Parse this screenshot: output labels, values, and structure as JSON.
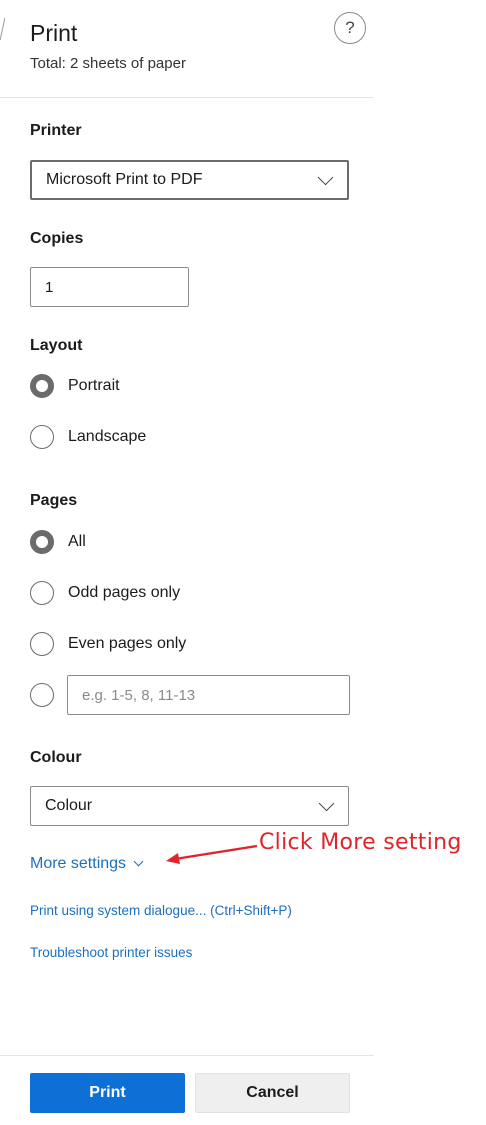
{
  "header": {
    "title": "Print",
    "subtitle": "Total: 2 sheets of paper",
    "help_label": "?",
    "help_icon": "question-icon"
  },
  "printer": {
    "label": "Printer",
    "selected": "Microsoft Print to PDF"
  },
  "copies": {
    "label": "Copies",
    "value": "1"
  },
  "layout": {
    "label": "Layout",
    "options": [
      {
        "label": "Portrait",
        "checked": true
      },
      {
        "label": "Landscape",
        "checked": false
      }
    ]
  },
  "pages": {
    "label": "Pages",
    "options": [
      {
        "label": "All",
        "checked": true
      },
      {
        "label": "Odd pages only",
        "checked": false
      },
      {
        "label": "Even pages only",
        "checked": false
      }
    ],
    "custom_placeholder": "e.g. 1-5, 8, 11-13"
  },
  "colour": {
    "label": "Colour",
    "selected": "Colour"
  },
  "links": {
    "more_settings": "More settings",
    "system_dialogue": "Print using system dialogue... (Ctrl+Shift+P)",
    "troubleshoot": "Troubleshoot printer issues"
  },
  "annotation": {
    "text": "Click More setting",
    "color": "#e0242a"
  },
  "footer": {
    "print_label": "Print",
    "cancel_label": "Cancel"
  },
  "colors": {
    "accent": "#0e6fd6",
    "link": "#1c6fbf"
  }
}
